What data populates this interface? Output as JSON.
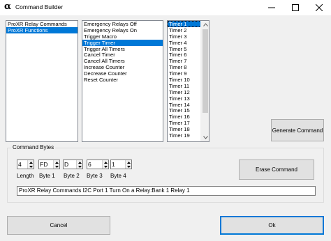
{
  "window": {
    "app_icon_glyph": "α",
    "title": "Command Builder"
  },
  "commands_list": {
    "items": [
      "ProXR Relay Commands",
      "ProXR Functions"
    ],
    "selected_index": 1
  },
  "functions_list": {
    "items": [
      "Emergency Relays Off",
      "Emergency Relays On",
      "Trigger Macro",
      "Trigger Timer",
      "Trigger All Timers",
      "Cancel Timer",
      "Cancel All Timers",
      "Increase Counter",
      "Decrease Counter",
      "Reset Counter"
    ],
    "selected_index": 3
  },
  "timers_list": {
    "items": [
      "Timer 1",
      "Timer 2",
      "Timer 3",
      "Timer 4",
      "Timer 5",
      "Timer 6",
      "Timer 7",
      "Timer 8",
      "Timer 9",
      "Timer 10",
      "Timer 11",
      "Timer 12",
      "Timer 13",
      "Timer 14",
      "Timer 15",
      "Timer 16",
      "Timer 17",
      "Timer 18",
      "Timer 19"
    ],
    "selected_index": 0
  },
  "buttons": {
    "generate": "Generate Command",
    "erase": "Erase Command",
    "cancel": "Cancel",
    "ok": "Ok"
  },
  "command_bytes": {
    "group_label": "Command Bytes",
    "length": {
      "value": "4",
      "label": "Length"
    },
    "byte1": {
      "value": "FD",
      "label": "Byte 1"
    },
    "byte2": {
      "value": "D",
      "label": "Byte 2"
    },
    "byte3": {
      "value": "6",
      "label": "Byte 3"
    },
    "byte4": {
      "value": "1",
      "label": "Byte 4"
    },
    "output": "ProXR Relay Commands I2C Port 1 Turn On a Relay:Bank 1 Relay 1"
  },
  "colors": {
    "selection": "#0078d7",
    "window_bg": "#f0f0f0"
  }
}
